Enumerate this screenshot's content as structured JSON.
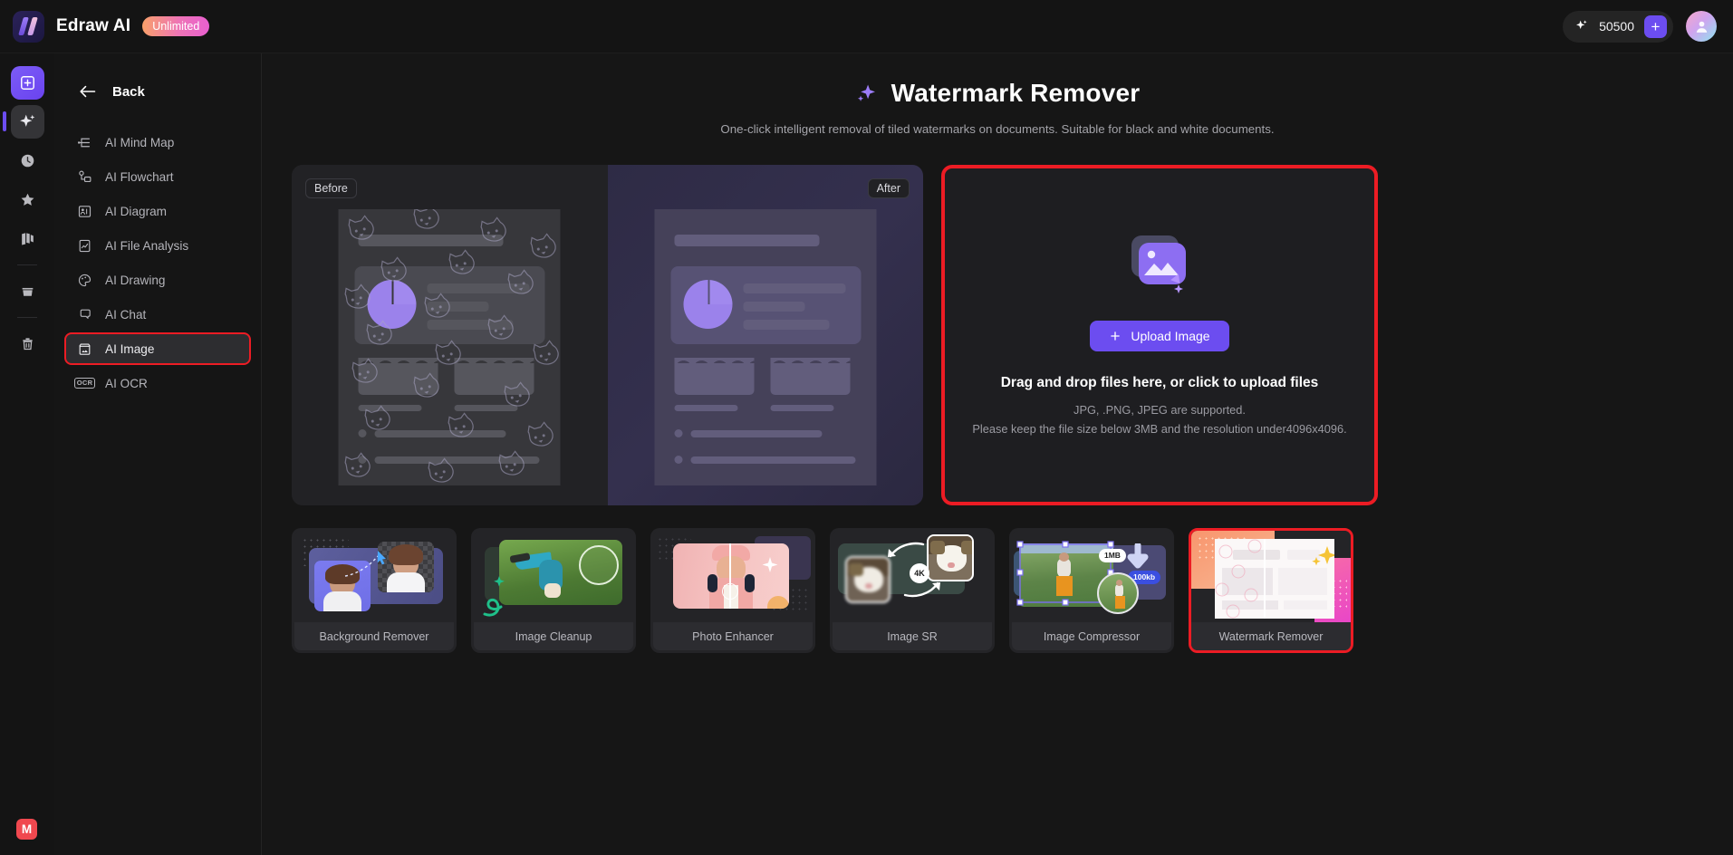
{
  "topbar": {
    "brand_name": "Edraw AI",
    "plan_badge": "Unlimited",
    "credits": "50500",
    "add_credits_label": "+",
    "logo_icon": "edraw-logo-icon",
    "credits_icon": "sparkle-icon",
    "avatar_icon": "user-avatar-icon"
  },
  "rail": {
    "items": [
      {
        "name": "new-document",
        "icon": "plus-square-icon"
      },
      {
        "name": "ai-tools",
        "icon": "sparkle-icon"
      },
      {
        "name": "recent",
        "icon": "clock-icon"
      },
      {
        "name": "favorites",
        "icon": "star-icon"
      },
      {
        "name": "gallery",
        "icon": "gallery-icon"
      },
      {
        "name": "files",
        "icon": "folder-icon"
      },
      {
        "name": "trash",
        "icon": "trash-icon"
      }
    ],
    "bottom_badge": "M"
  },
  "sidebar": {
    "back_label": "Back",
    "back_icon": "arrow-left-icon",
    "items": [
      {
        "label": "AI Mind Map",
        "icon": "mind-map-icon",
        "selected": false
      },
      {
        "label": "AI Flowchart",
        "icon": "flowchart-icon",
        "selected": false
      },
      {
        "label": "AI Diagram",
        "icon": "diagram-icon",
        "selected": false
      },
      {
        "label": "AI File Analysis",
        "icon": "file-analysis-icon",
        "selected": false
      },
      {
        "label": "AI Drawing",
        "icon": "palette-icon",
        "selected": false
      },
      {
        "label": "AI Chat",
        "icon": "chat-bubble-icon",
        "selected": false
      },
      {
        "label": "AI Image",
        "icon": "image-icon",
        "selected": true
      },
      {
        "label": "AI OCR",
        "icon": "ocr-icon",
        "selected": false
      }
    ]
  },
  "page": {
    "title": "Watermark Remover",
    "title_icon": "sparkle-icon",
    "subtitle": "One-click intelligent removal of tiled watermarks on documents. Suitable for black and white documents."
  },
  "preview": {
    "before_label": "Before",
    "after_label": "After",
    "watermark_glyph": "cat-face-watermark-icon"
  },
  "upload": {
    "image_icon": "image-upload-icon",
    "button_label": "Upload Image",
    "button_icon": "plus-icon",
    "headline": "Drag and drop files here, or click to upload files",
    "formats_note": "JPG, .PNG, JPEG are supported.",
    "limits_note": "Please keep the file size below 3MB and the resolution under4096x4096."
  },
  "tools": [
    {
      "label": "Background Remover",
      "selected": false
    },
    {
      "label": "Image Cleanup",
      "selected": false
    },
    {
      "label": "Photo Enhancer",
      "selected": false
    },
    {
      "label": "Image SR",
      "selected": false,
      "badge": "4K"
    },
    {
      "label": "Image Compressor",
      "selected": false,
      "badge_from": "1MB",
      "badge_to": "100kb"
    },
    {
      "label": "Watermark Remover",
      "selected": true
    }
  ],
  "colors": {
    "accent_purple": "#6c4df0",
    "highlight_red": "#ec1c24",
    "app_bg": "#141414",
    "panel_bg": "#1e1e21"
  }
}
